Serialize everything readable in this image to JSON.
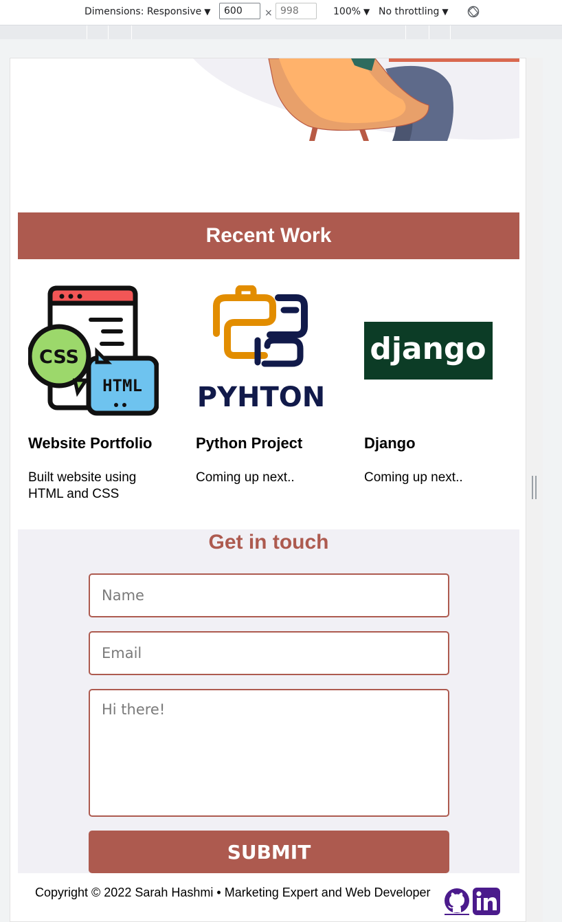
{
  "devtools": {
    "dimensions_label": "Dimensions: Responsive",
    "width_value": "600",
    "times": "×",
    "height_placeholder": "998",
    "zoom": "100%",
    "throttling": "No throttling",
    "caret": "▼"
  },
  "recent_work": {
    "title": "Recent Work",
    "projects": [
      {
        "title": "Website Portfolio",
        "description": "Built website using HTML and CSS",
        "logo_text_1": "CSS",
        "logo_text_2": "HTML"
      },
      {
        "title": "Python Project",
        "description": "Coming up next..",
        "logo_text": "PYHTON"
      },
      {
        "title": "Django",
        "description": "Coming up next..",
        "logo_text": "django"
      }
    ]
  },
  "contact": {
    "title": "Get in touch",
    "name_placeholder": "Name",
    "email_placeholder": "Email",
    "message_placeholder": "Hi there!",
    "submit_label": "SUBMIT"
  },
  "footer": {
    "copyright": "Copyright © 2022 Sarah Hashmi • Marketing Expert and Web Developer"
  },
  "social_icons": [
    "github-icon",
    "linkedin-icon"
  ],
  "colors": {
    "accent": "#ad5a4f",
    "contact_bg": "#f1f0f5",
    "social": "#4b1b8c",
    "django_bg": "#0c3c26"
  }
}
